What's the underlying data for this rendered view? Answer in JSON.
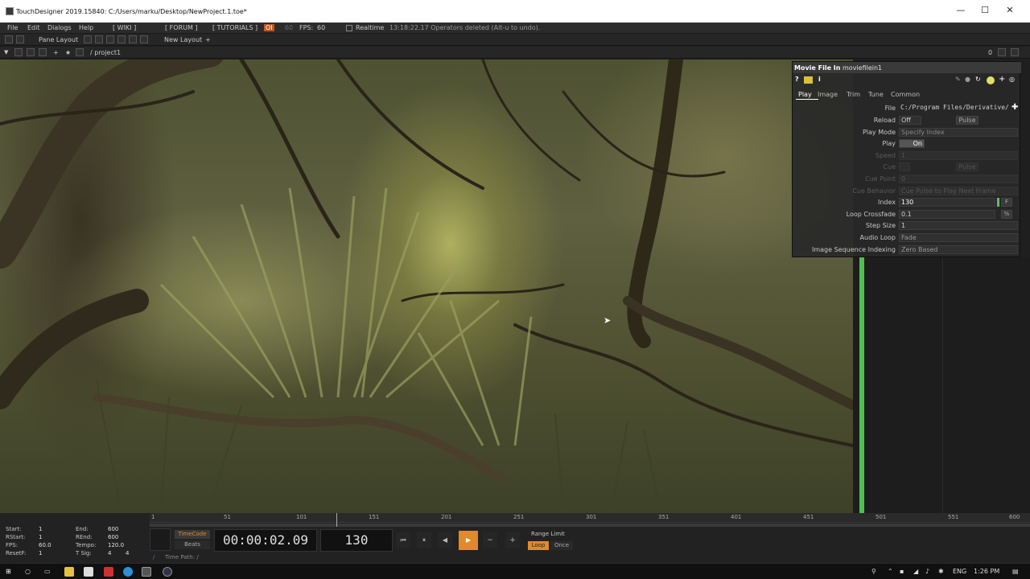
{
  "window": {
    "title": "TouchDesigner 2019.15840: C:/Users/marku/Desktop/NewProject.1.toe*",
    "min": "—",
    "max": "☐",
    "close": "✕"
  },
  "menu": {
    "items": [
      "File",
      "Edit",
      "Dialogs",
      "Help"
    ],
    "wiki": "[ WIKI ]",
    "forum": "[ FORUM ]",
    "tutorials": "[ TUTORIALS ]",
    "oi": "OI",
    "fps_small": "60",
    "fps_label": "FPS:",
    "fps_value": "60",
    "realtime": "Realtime",
    "status": "13:18:22.17 Operators deleted (Alt-u to undo)."
  },
  "toolbar": {
    "pane_layout": "Pane Layout",
    "new_layout": "New Layout",
    "plus": "+"
  },
  "path": {
    "label": "/ project1",
    "zero": "0"
  },
  "params": {
    "op_type": "Movie File In",
    "op_name": "moviefilein1",
    "tabs": [
      "Play",
      "Image",
      "Trim",
      "Tune",
      "Common"
    ],
    "rows": [
      {
        "label": "File",
        "value": "C:/Program Files/Derivative/"
      },
      {
        "label": "Reload",
        "value": "Off",
        "button": "Pulse"
      },
      {
        "label": "Play Mode",
        "value": "Specify Index"
      },
      {
        "label": "Play",
        "value": "On"
      },
      {
        "label": "Speed",
        "value": "1"
      },
      {
        "label": "Cue",
        "value": "",
        "button": "Pulse"
      },
      {
        "label": "Cue Point",
        "value": "0"
      },
      {
        "label": "Cue Behavior",
        "value": "Cue Pulse to Play Next Frame"
      },
      {
        "label": "Index",
        "value": "130",
        "unit": "F"
      },
      {
        "label": "Loop Crossfade",
        "value": "0.1",
        "unit": "%"
      },
      {
        "label": "Step Size",
        "value": "1"
      },
      {
        "label": "Audio Loop",
        "value": "Fade"
      },
      {
        "label": "Image Sequence Indexing",
        "value": "Zero Based"
      }
    ]
  },
  "timeline": {
    "ticks": [
      "1",
      "51",
      "101",
      "151",
      "201",
      "251",
      "301",
      "351",
      "401",
      "451",
      "501",
      "551",
      "600"
    ],
    "stats": {
      "start_label": "Start:",
      "start": "1",
      "end_label": "End:",
      "end": "600",
      "rstart_label": "RStart:",
      "rstart": "1",
      "rend_label": "REnd:",
      "rend": "600",
      "fps_label": "FPS:",
      "fps": "60.0",
      "tempo_label": "Tempo:",
      "tempo": "120.0",
      "resetf_label": "ResetF:",
      "resetf": "1",
      "tsig_label": "T Sig:",
      "tsig1": "4",
      "tsig2": "4"
    },
    "timecode": "TimeCode",
    "beats": "Beats",
    "time_display": "00:00:02.09",
    "frame": "130",
    "range_limit": "Range Limit",
    "loop": "Loop",
    "once": "Once",
    "time_path": "Time Path: /"
  },
  "taskbar": {
    "lang": "ENG",
    "time": "1:26 PM"
  },
  "colors": {
    "accent": "#e08a2a",
    "green": "#4ec04e"
  }
}
